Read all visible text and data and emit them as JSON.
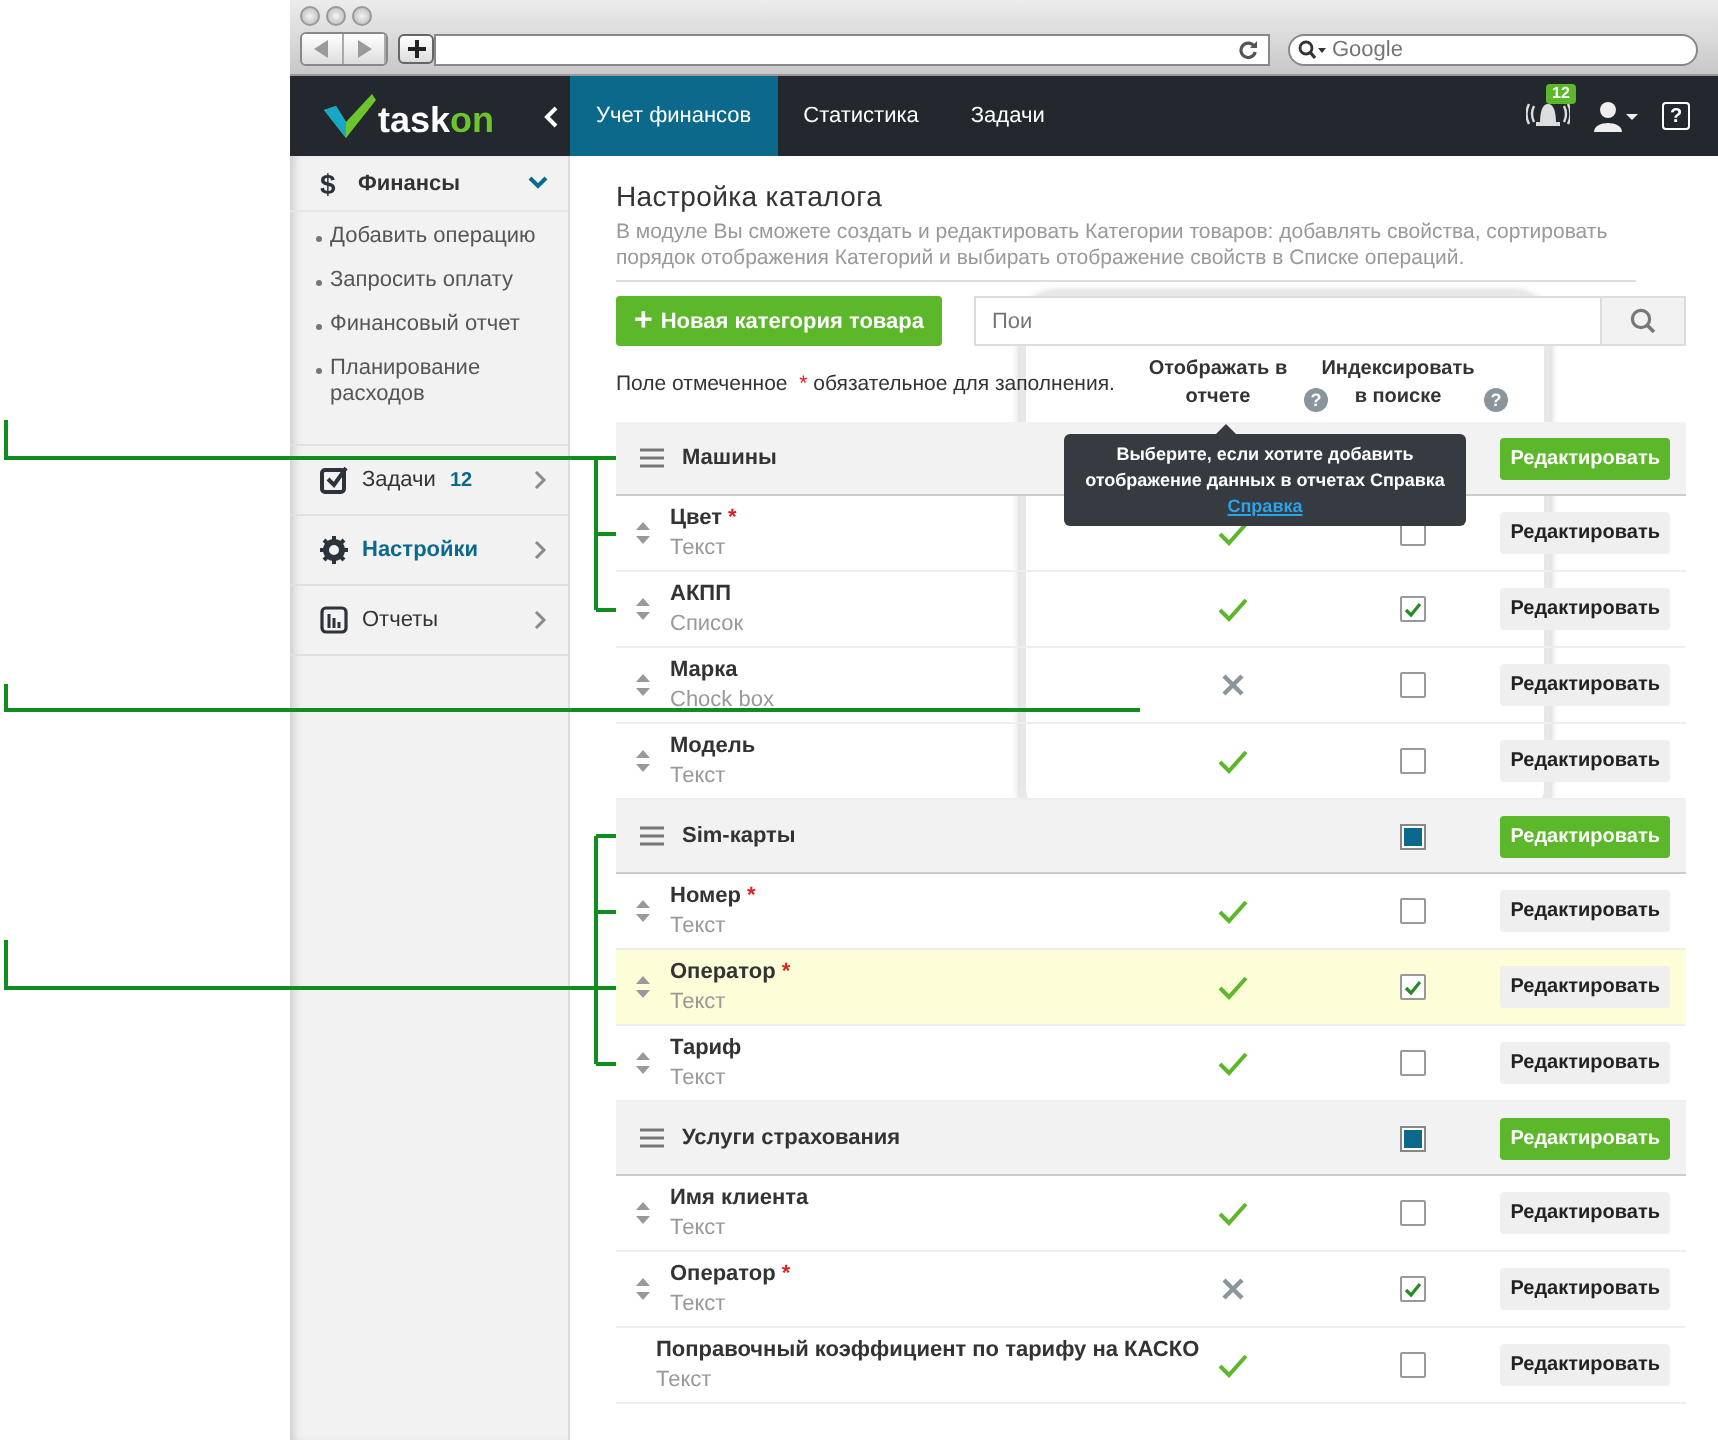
{
  "browser": {
    "search_placeholder": "Google"
  },
  "app": {
    "logo": {
      "text": "task",
      "accent": "on"
    },
    "tabs": [
      {
        "label": "Учет финансов",
        "selected": true
      },
      {
        "label": "Статистика",
        "selected": false
      },
      {
        "label": "Задачи",
        "selected": false
      }
    ],
    "notifications": "12",
    "help": "?"
  },
  "sidebar": {
    "items": [
      {
        "kind": "currency",
        "icon": "$",
        "label": "Финансы",
        "expanded": true,
        "active": false,
        "children": [
          {
            "label": "Добавить операцию"
          },
          {
            "label": "Запросить оплату"
          },
          {
            "label": "Финансовый отчет"
          },
          {
            "label": "Планирование расходов"
          }
        ]
      },
      {
        "kind": "tasks",
        "label": "Задачи",
        "count": "12",
        "expanded": false,
        "active": false
      },
      {
        "kind": "settings",
        "label": "Настройки",
        "expanded": false,
        "active": true
      },
      {
        "kind": "reports",
        "label": "Отчеты",
        "expanded": false,
        "active": false
      }
    ]
  },
  "page": {
    "title": "Настройка каталога",
    "description": "В модуле Вы сможете создать и редактировать Категории товаров: добавлять свойства, сортировать порядок отображения Категорий и выбирать отображение свойств в Списке операций.",
    "new_button": {
      "icon": "+",
      "label": "Новая категория товара"
    },
    "search": {
      "placeholder": "Пои"
    },
    "required_note": {
      "before": "Поле отмеченное",
      "mark": "*",
      "after": "обязательное для заполнения."
    },
    "columns": [
      {
        "label": "Отображать в отчете",
        "help": "?"
      },
      {
        "label": "Индексировать в поиске",
        "help": "?"
      }
    ],
    "groups": [
      {
        "name": "Машины",
        "edit": "Редактировать",
        "fields": [
          {
            "name": "Цвет",
            "required_mark": "*",
            "type": "Текст",
            "report": true,
            "indexed": false,
            "highlighted": false,
            "edit": "Редактировать"
          },
          {
            "name": "АКПП",
            "type": "Список",
            "report": true,
            "indexed": true,
            "highlighted": false,
            "edit": "Редактировать"
          },
          {
            "name": "Марка",
            "type": "Chock box",
            "report": false,
            "indexed": false,
            "highlighted": false,
            "edit": "Редактировать"
          },
          {
            "name": "Модель",
            "type": "Текст",
            "report": true,
            "indexed": false,
            "highlighted": false,
            "edit": "Редактировать"
          }
        ]
      },
      {
        "name": "Sim-карты",
        "indexed": true,
        "edit": "Редактировать",
        "fields": [
          {
            "name": "Номер",
            "required_mark": "*",
            "type": "Текст",
            "report": true,
            "indexed": false,
            "highlighted": false,
            "edit": "Редактировать"
          },
          {
            "name": "Оператор",
            "required_mark": "*",
            "type": "Текст",
            "report": true,
            "indexed": true,
            "highlighted": true,
            "edit": "Редактировать"
          },
          {
            "name": "Тариф",
            "type": "Текст",
            "report": true,
            "indexed": false,
            "highlighted": false,
            "edit": "Редактировать"
          }
        ]
      },
      {
        "name": "Услуги страхования",
        "indexed": true,
        "edit": "Редактировать",
        "fields": [
          {
            "name": "Имя клиента",
            "type": "Текст",
            "report": true,
            "indexed": false,
            "highlighted": false,
            "edit": "Редактировать"
          },
          {
            "name": "Оператор",
            "required_mark": "*",
            "type": "Текст",
            "report": false,
            "indexed": true,
            "highlighted": false,
            "edit": "Редактировать"
          },
          {
            "name": "Поправочный коэффициент по тарифу на КАСКО",
            "type": "Текст",
            "report": true,
            "indexed": false,
            "highlighted": false,
            "edit": "Редактировать"
          }
        ]
      }
    ],
    "tooltip": {
      "text": "Выберите, если хотите добавить отображение данных в отчетах Справка",
      "link": "Справка"
    }
  }
}
